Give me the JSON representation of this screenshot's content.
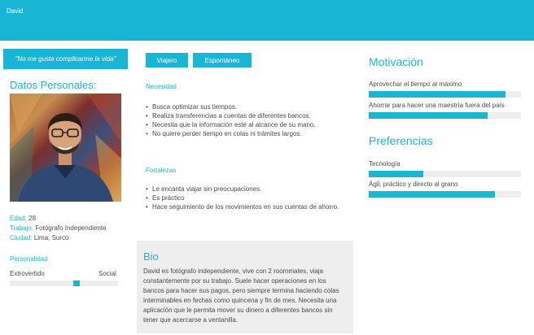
{
  "header": {
    "name": "David"
  },
  "quote": "\"No me gusta complicarme la vida\"",
  "datos": {
    "title": "Datos Personales:",
    "edad_key": "Edad:",
    "edad_val": "28",
    "trabajo_key": "Trabajo:",
    "trabajo_val": "Fotógrafo Independiente",
    "ciudad_key": "Ciudad:",
    "ciudad_val": "Lima, Surco"
  },
  "personalidad": {
    "label": "Personalidad",
    "left": "Extrovertido",
    "right": "Social",
    "value_percent": 62
  },
  "tags": [
    "Viajero",
    "Espontáneo"
  ],
  "necesidad": {
    "label": "Necesidad",
    "items": [
      "Busca optimizar sus tiempos.",
      "Realiza transferencias a cuentas de diferentes bancos.",
      "Necesita que la información esté al alcance de su mano.",
      "No quiere perder tiempo en colas ni trámites largos."
    ]
  },
  "fortalezas": {
    "label": "Fortalezas",
    "items": [
      "Le encanta viajar sin preocupaciones.",
      "Es práctico",
      "Hace seguimiento de los movimientos en sus cuentas de ahorro."
    ]
  },
  "bio": {
    "title": "Bio",
    "text": "David es fotógrafo independiente, vive con 2 roommates, viaja constantemente por su trabajo. Suele hacer operaciones en los bancos para hacer sus pagos, pero siempre termina haciendo colas interminables en fechas como quincena y fin de mes. Necesita una aplicación que le permita mover su dinero a diferentes bancos sin tener que acercarse a ventanilla."
  },
  "motivacion": {
    "title": "Motivación",
    "items": [
      {
        "label": "Aprovechar el tiempo al máximo",
        "percent": 90
      },
      {
        "label": "Ahorrar para hacer una maestría fuera del país",
        "percent": 78
      }
    ]
  },
  "preferencias": {
    "title": "Preferencias",
    "items": [
      {
        "label": "Tecnología",
        "percent": 36
      },
      {
        "label": "Ágil, práctico y directo al grano",
        "percent": 83
      }
    ]
  },
  "colors": {
    "accent": "#19b5d4",
    "track": "#eeeeee",
    "text": "#4a4a4a"
  }
}
